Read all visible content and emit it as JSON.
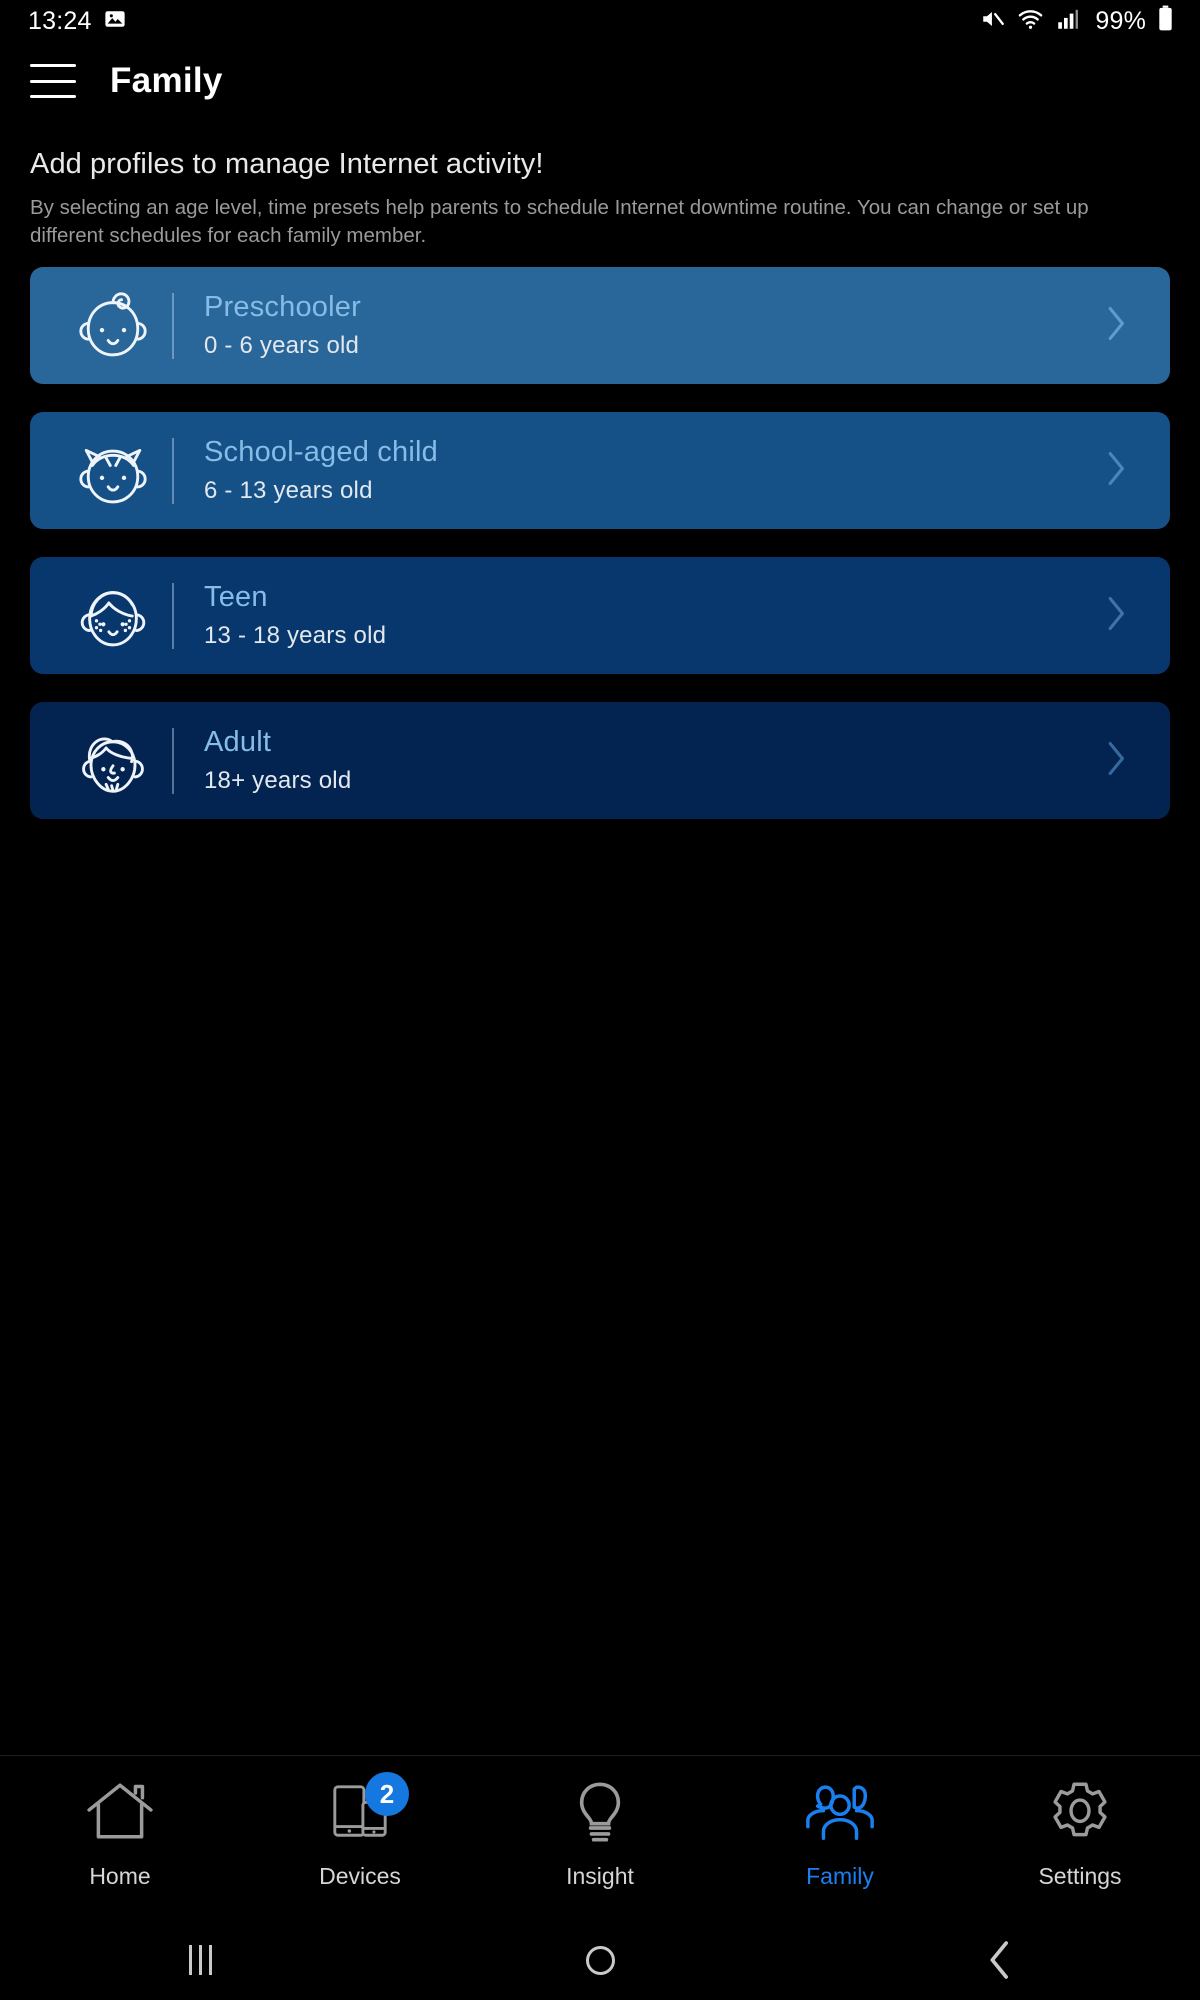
{
  "status_bar": {
    "time": "13:24",
    "battery_percent": "99%",
    "icons": [
      "image-icon",
      "mute-icon",
      "wifi-icon",
      "cellular-signal-icon",
      "battery-icon"
    ]
  },
  "app_bar": {
    "menu_icon": "hamburger-menu-icon",
    "title": "Family"
  },
  "intro": {
    "heading": "Add profiles to manage Internet activity!",
    "description": "By selecting an age level, time presets help parents to schedule Internet downtime routine. You can change or set up different schedules for each family member."
  },
  "profile_cards": [
    {
      "title": "Preschooler",
      "age": "0 - 6 years old",
      "icon": "baby-face-icon",
      "bg": "#296699"
    },
    {
      "title": "School-aged child",
      "age": "6 - 13 years old",
      "icon": "child-face-icon",
      "bg": "#155087"
    },
    {
      "title": "Teen",
      "age": "13 - 18 years old",
      "icon": "teen-face-icon",
      "bg": "#08376E"
    },
    {
      "title": "Adult",
      "age": "18+ years old",
      "icon": "adult-face-icon",
      "bg": "#032450"
    }
  ],
  "bottom_nav": {
    "items": [
      {
        "label": "Home",
        "icon": "house-icon",
        "active": false,
        "badge": ""
      },
      {
        "label": "Devices",
        "icon": "devices-icon",
        "active": false,
        "badge": "2"
      },
      {
        "label": "Insight",
        "icon": "lightbulb-icon",
        "active": false,
        "badge": ""
      },
      {
        "label": "Family",
        "icon": "people-icon",
        "active": true,
        "badge": ""
      },
      {
        "label": "Settings",
        "icon": "gear-icon",
        "active": false,
        "badge": ""
      }
    ],
    "active_color": "#1a7ff0",
    "inactive_color": "#9b9b9b"
  },
  "system_nav": {
    "recents_label": "recents-button",
    "home_label": "home-button",
    "back_label": "back-button"
  }
}
